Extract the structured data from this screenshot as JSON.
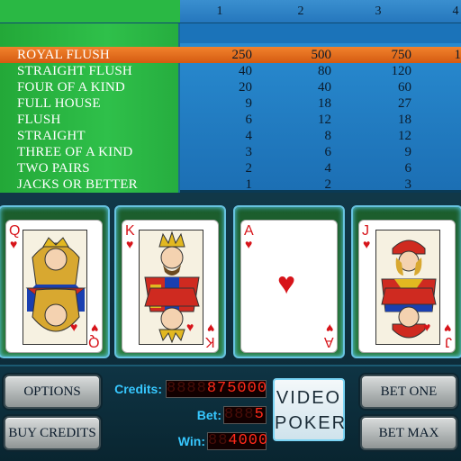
{
  "paytable": {
    "columns": [
      "1",
      "2",
      "3",
      "4"
    ],
    "rows": [
      {
        "hand": "ROYAL FLUSH",
        "values": [
          "250",
          "500",
          "750",
          "1"
        ]
      },
      {
        "hand": "STRAIGHT FLUSH",
        "values": [
          "40",
          "80",
          "120",
          ""
        ]
      },
      {
        "hand": "FOUR OF A KIND",
        "values": [
          "20",
          "40",
          "60",
          ""
        ]
      },
      {
        "hand": "FULL HOUSE",
        "values": [
          "9",
          "18",
          "27",
          ""
        ]
      },
      {
        "hand": "FLUSH",
        "values": [
          "6",
          "12",
          "18",
          ""
        ]
      },
      {
        "hand": "STRAIGHT",
        "values": [
          "4",
          "8",
          "12",
          ""
        ]
      },
      {
        "hand": "THREE OF A KIND",
        "values": [
          "3",
          "6",
          "9",
          ""
        ]
      },
      {
        "hand": "TWO PAIRS",
        "values": [
          "2",
          "4",
          "6",
          ""
        ]
      },
      {
        "hand": "JACKS OR BETTER",
        "values": [
          "1",
          "2",
          "3",
          ""
        ]
      }
    ],
    "highlight_color": "#e8701e"
  },
  "cards": [
    {
      "rank": "Q",
      "suit": "hearts",
      "suit_glyph": "♥"
    },
    {
      "rank": "K",
      "suit": "hearts",
      "suit_glyph": "♥"
    },
    {
      "rank": "A",
      "suit": "hearts",
      "suit_glyph": "♥"
    },
    {
      "rank": "J",
      "suit": "hearts",
      "suit_glyph": "♥"
    }
  ],
  "buttons": {
    "options": "OPTIONS",
    "buy_credits": "BUY CREDITS",
    "bet_one": "BET ONE",
    "bet_max": "BET MAX"
  },
  "displays": {
    "credits_label": "Credits:",
    "credits_value": "875000",
    "credits_ghost": "8888",
    "bet_label": "Bet:",
    "bet_value": "5",
    "bet_ghost": "888",
    "win_label": "Win:",
    "win_value": "4000",
    "win_ghost": "88"
  },
  "logo": {
    "line1": "VIDEO",
    "line2": "POKER"
  }
}
